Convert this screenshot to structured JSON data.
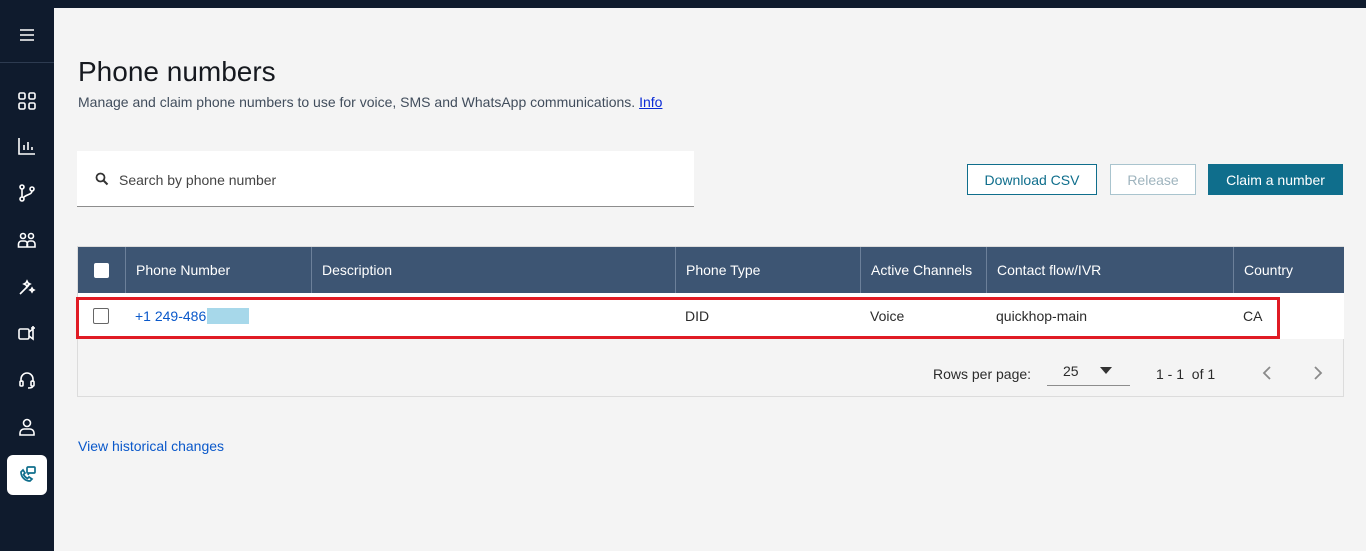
{
  "sidebar": {
    "menu_icon": "hamburger-icon",
    "items": [
      {
        "icon": "dashboard-icon",
        "active": false
      },
      {
        "icon": "analytics-icon",
        "active": false
      },
      {
        "icon": "routing-icon",
        "active": false
      },
      {
        "icon": "users-icon",
        "active": false
      },
      {
        "icon": "wand-icon",
        "active": false
      },
      {
        "icon": "channels-icon",
        "active": false
      },
      {
        "icon": "headset-icon",
        "active": false
      },
      {
        "icon": "user-icon",
        "active": false
      },
      {
        "icon": "phone-numbers-icon",
        "active": true
      }
    ]
  },
  "page": {
    "title": "Phone numbers",
    "subtitle": "Manage and claim phone numbers to use for voice, SMS and WhatsApp communications.",
    "info_link": "Info"
  },
  "search": {
    "placeholder": "Search by phone number",
    "value": ""
  },
  "actions": {
    "download_csv": "Download CSV",
    "release": "Release",
    "claim": "Claim a number"
  },
  "table": {
    "headers": [
      "Phone Number",
      "Description",
      "Phone Type",
      "Active Channels",
      "Contact flow/IVR",
      "Country"
    ],
    "rows": [
      {
        "phone_number": "+1 249-486",
        "description": "",
        "phone_type": "DID",
        "active_channels": "Voice",
        "contact_flow": "quickhop-main",
        "country": "CA"
      }
    ]
  },
  "pagination": {
    "rows_per_page_label": "Rows per page:",
    "rows_per_page_value": "25",
    "range": "1 - 1  of 1"
  },
  "footer": {
    "history_link": "View historical changes"
  },
  "colors": {
    "sidebar": "#0f1b2d",
    "table_header": "#3d5573",
    "primary": "#0f6e8c",
    "highlight": "#e01b24"
  }
}
